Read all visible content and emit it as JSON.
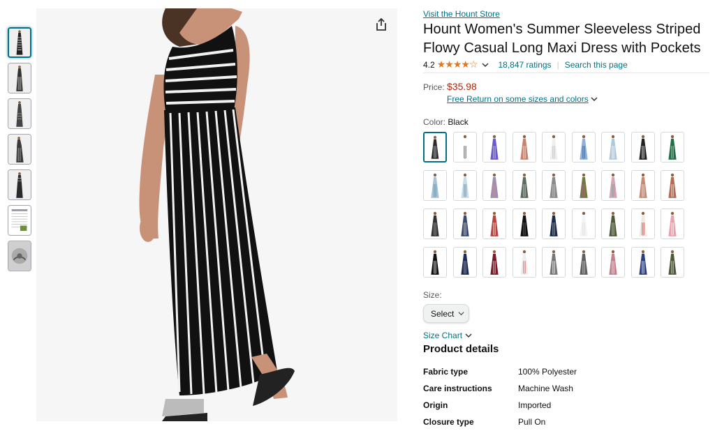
{
  "store_link": "Visit the Hount Store",
  "title": "Hount Women's Summer Sleeveless Striped Flowy Casual Long Maxi Dress with Pockets",
  "rating": {
    "value": "4.2",
    "stars": 4.2,
    "count_label": "18,847 ratings",
    "separator": "|",
    "search_label": "Search this page"
  },
  "price": {
    "label": "Price:",
    "value": "$35.98",
    "free_return": "Free Return on some sizes and colors"
  },
  "color": {
    "label": "Color:",
    "selected": "Black",
    "accent": "#007185"
  },
  "size": {
    "label": "Size:",
    "select_value": "Select",
    "size_chart": "Size Chart"
  },
  "product_details": {
    "title": "Product details",
    "rows": [
      {
        "key": "Fabric type",
        "value": "100% Polyester"
      },
      {
        "key": "Care instructions",
        "value": "Machine Wash"
      },
      {
        "key": "Origin",
        "value": "Imported"
      },
      {
        "key": "Closure type",
        "value": "Pull On"
      }
    ]
  },
  "colors": {
    "link": "#007185",
    "price": "#b12704",
    "star": "#de7921"
  }
}
